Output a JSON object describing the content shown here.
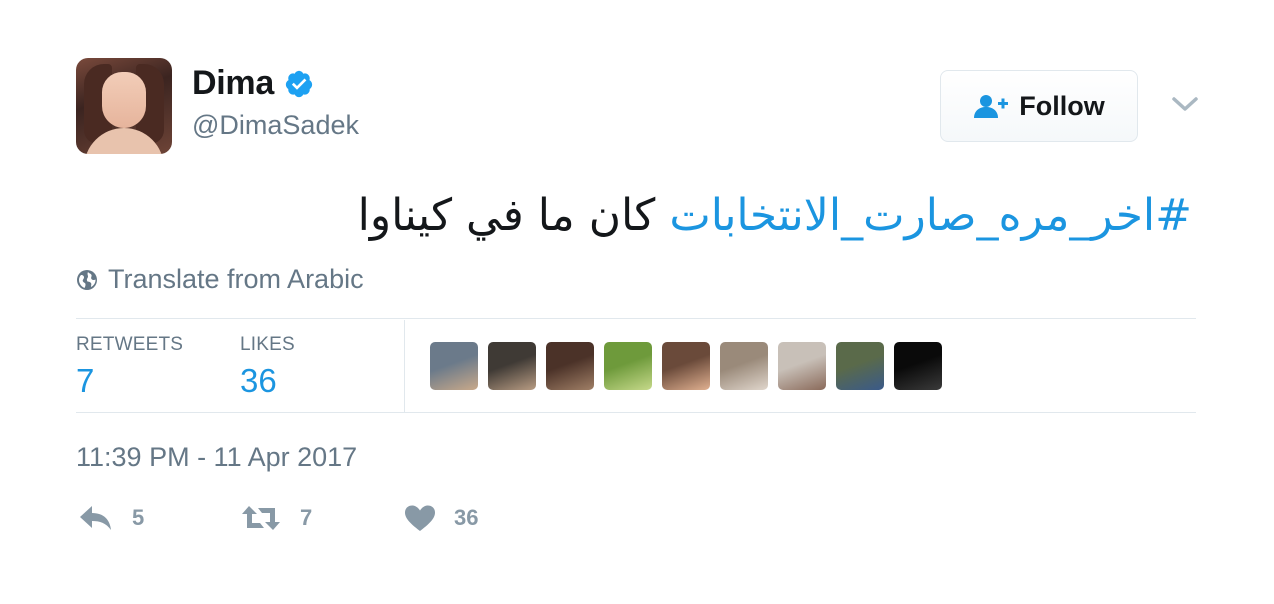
{
  "author": {
    "name": "Dima",
    "handle": "@DimaSadek",
    "verified": true,
    "avatar_icon": "profile-photo"
  },
  "follow_button": {
    "label": "Follow",
    "icon": "add-user-icon"
  },
  "tweet": {
    "hashtag": "#اخر_مره_صارت_الانتخابات",
    "text": " كان ما في كيناوا"
  },
  "translate": {
    "label": "Translate from Arabic",
    "icon": "globe-icon"
  },
  "stats": {
    "retweets_label": "RETWEETS",
    "retweets_value": "7",
    "likes_label": "LIKES",
    "likes_value": "36"
  },
  "likers": [
    {
      "colors": [
        "#6b7a8a",
        "#c9a98a"
      ]
    },
    {
      "colors": [
        "#3f3a35",
        "#b89c83"
      ]
    },
    {
      "colors": [
        "#4b3228",
        "#a07f66"
      ]
    },
    {
      "colors": [
        "#6e9a3b",
        "#c6d98a"
      ]
    },
    {
      "colors": [
        "#6a4a3a",
        "#e0b090"
      ]
    },
    {
      "colors": [
        "#9a8a7a",
        "#e0d6cc"
      ]
    },
    {
      "colors": [
        "#c8c0b8",
        "#8a6a5a"
      ]
    },
    {
      "colors": [
        "#5a6a4a",
        "#3a5a8a"
      ]
    },
    {
      "colors": [
        "#0a0a0a",
        "#3a3a3a"
      ]
    }
  ],
  "timestamp": "11:39 PM - 11 Apr 2017",
  "actions": {
    "reply_count": "5",
    "retweet_count": "7",
    "like_count": "36"
  },
  "colors": {
    "accent": "#1b95e0",
    "muted": "#657786",
    "action": "#8899a6",
    "border": "#e1e8ed"
  }
}
